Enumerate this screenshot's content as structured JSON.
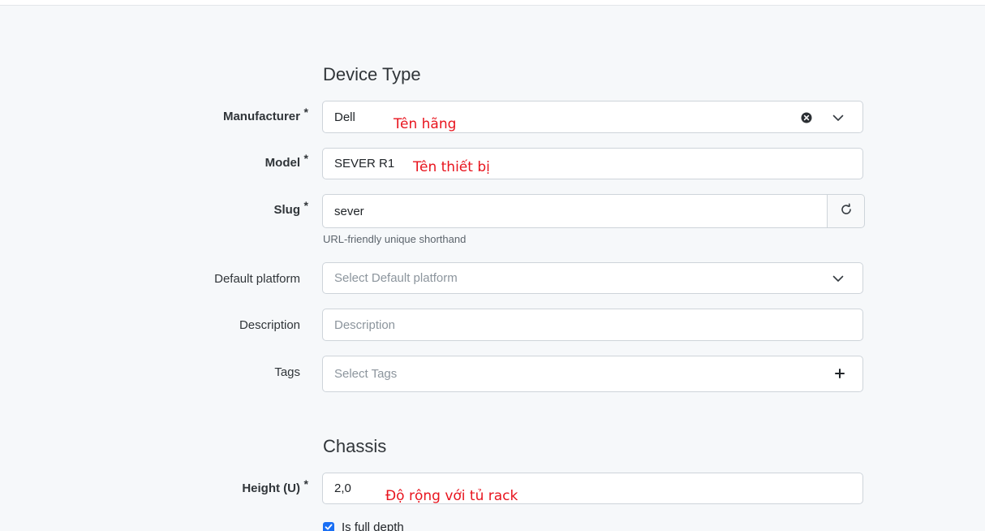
{
  "sections": {
    "device_type": "Device Type",
    "chassis": "Chassis"
  },
  "fields": {
    "manufacturer": {
      "label": "Manufacturer",
      "required_mark": "*",
      "value": "Dell",
      "annotation": "Tên hãng"
    },
    "model": {
      "label": "Model",
      "required_mark": "*",
      "value": "SEVER R1",
      "annotation": "Tên thiết bị"
    },
    "slug": {
      "label": "Slug",
      "required_mark": "*",
      "value": "sever",
      "help": "URL-friendly unique shorthand"
    },
    "default_platform": {
      "label": "Default platform",
      "placeholder": "Select Default platform"
    },
    "description": {
      "label": "Description",
      "placeholder": "Description"
    },
    "tags": {
      "label": "Tags",
      "placeholder": "Select Tags"
    },
    "height": {
      "label": "Height (U)",
      "required_mark": "*",
      "value": "2,0",
      "annotation": "Độ rộng với tủ rack"
    },
    "full_depth": {
      "label": "Is full depth",
      "checked": true
    }
  },
  "icons": {
    "clear": "clear-circle-icon",
    "chevron": "chevron-down-icon",
    "refresh": "refresh-icon",
    "add": "plus-icon",
    "check": "checkmark-icon"
  },
  "colors": {
    "annotation": "#e8141e",
    "checkbox_accent": "#1a6ff4"
  }
}
